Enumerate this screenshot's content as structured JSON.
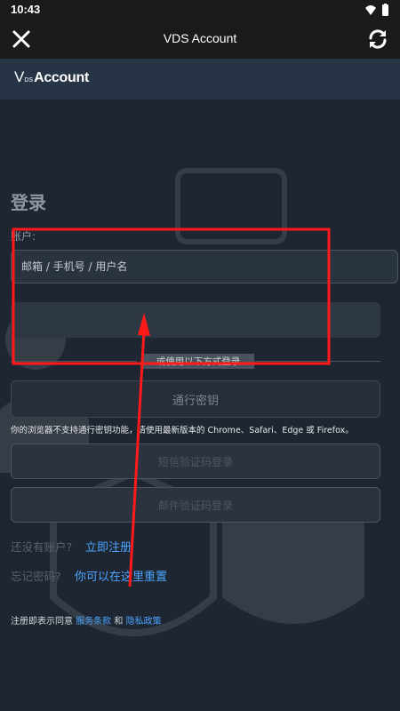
{
  "status_bar": {
    "time": "10:43",
    "icons": [
      "wifi-icon",
      "battery-icon"
    ]
  },
  "title_bar": {
    "title": "VDS Account",
    "close_icon": "close-icon",
    "refresh_icon": "refresh-icon"
  },
  "brand": {
    "logo_v": "V",
    "logo_ds": "DS",
    "logo_account": "Account"
  },
  "login": {
    "heading": "登录",
    "account_label": "账户:",
    "account_placeholder": "邮箱 / 手机号 / 用户名",
    "divider_text": "或使用以下方式登录",
    "passkey_button": "通行密钥",
    "passkey_note": "你的浏览器不支持通行密钥功能，请使用最新版本的 Chrome、Safari、Edge 或 Firefox。",
    "sms_button": "短信验证码登录",
    "email_button": "邮件验证码登录",
    "no_account_text": "还没有账户?",
    "register_link": "立即注册",
    "forgot_text": "忘记密码?",
    "reset_link": "你可以在这里重置",
    "terms_prefix": "注册即表示同意",
    "terms_link": "服务条款",
    "terms_and": "和",
    "privacy_link": "隐私政策"
  },
  "colors": {
    "accent_link": "#4ea3ff",
    "annotation_red": "#ff1a1a",
    "brand_bar": "#263446",
    "background": "#1e2731"
  }
}
